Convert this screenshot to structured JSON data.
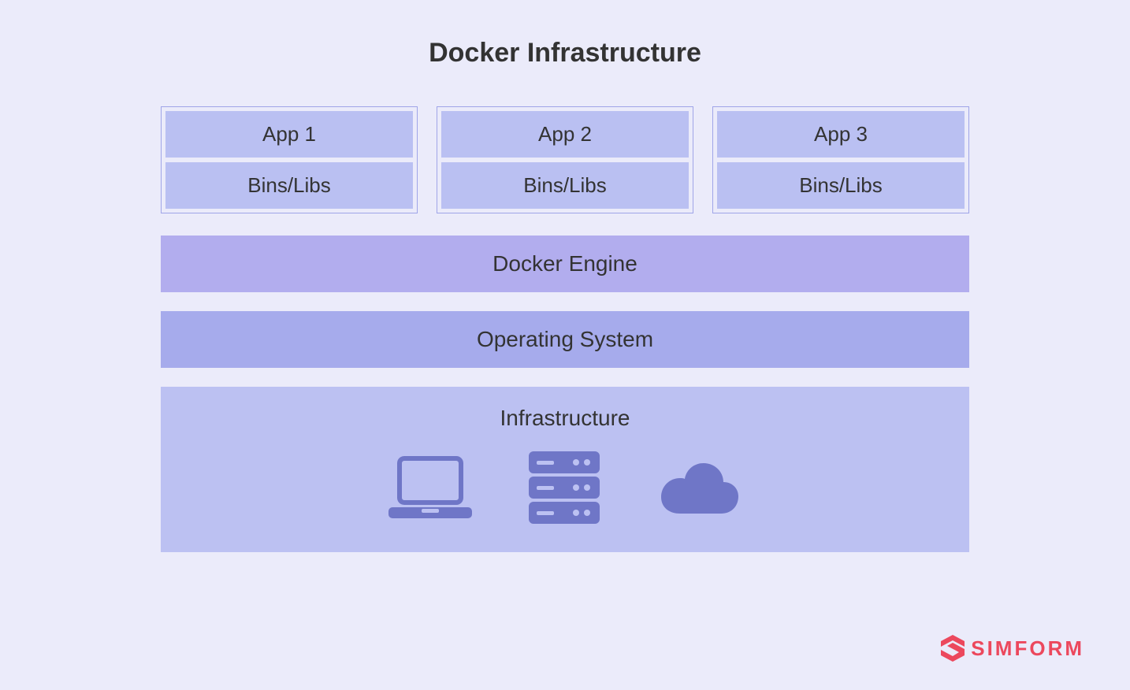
{
  "title": "Docker Infrastructure",
  "containers": [
    {
      "app": "App 1",
      "libs": "Bins/Libs"
    },
    {
      "app": "App 2",
      "libs": "Bins/Libs"
    },
    {
      "app": "App 3",
      "libs": "Bins/Libs"
    }
  ],
  "layers": {
    "engine": "Docker Engine",
    "os": "Operating System",
    "infrastructure": "Infrastructure"
  },
  "brand": "SIMFORM"
}
